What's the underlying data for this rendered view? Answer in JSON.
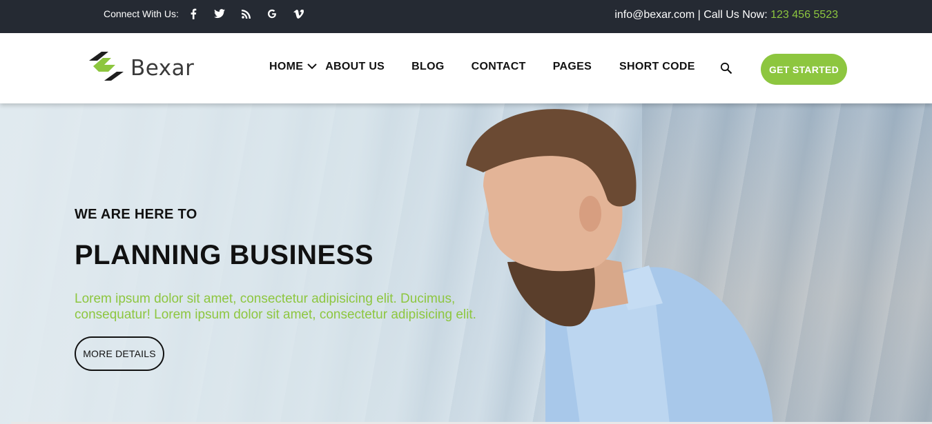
{
  "topbar": {
    "connect_label": "Connect With Us:",
    "socials": [
      {
        "icon": "facebook-icon"
      },
      {
        "icon": "twitter-icon"
      },
      {
        "icon": "rss-icon"
      },
      {
        "icon": "google-icon"
      },
      {
        "icon": "vimeo-icon"
      }
    ],
    "email_text": "info@bexar.com | Call Us Now: ",
    "phone": "123 456 5523"
  },
  "nav": {
    "logo_text": "Bexar",
    "items": [
      {
        "label": "HOME"
      },
      {
        "label": "ABOUT US"
      },
      {
        "label": "BLOG"
      },
      {
        "label": "CONTACT"
      },
      {
        "label": "PAGES"
      },
      {
        "label": "SHORT CODE"
      }
    ],
    "cta_label": "GET STARTED"
  },
  "hero": {
    "subtitle": "WE ARE HERE TO",
    "title": "PLANNING BUSINESS",
    "description": "Lorem ipsum dolor sit amet, consectetur adipisicing elit. Ducimus, consequatur! Lorem ipsum dolor sit amet, consectetur adipisicing elit.",
    "button_label": "MORE DETAILS"
  },
  "colors": {
    "accent": "#8dc63f",
    "topbar_bg": "#252a33",
    "text_dark": "#111111"
  }
}
